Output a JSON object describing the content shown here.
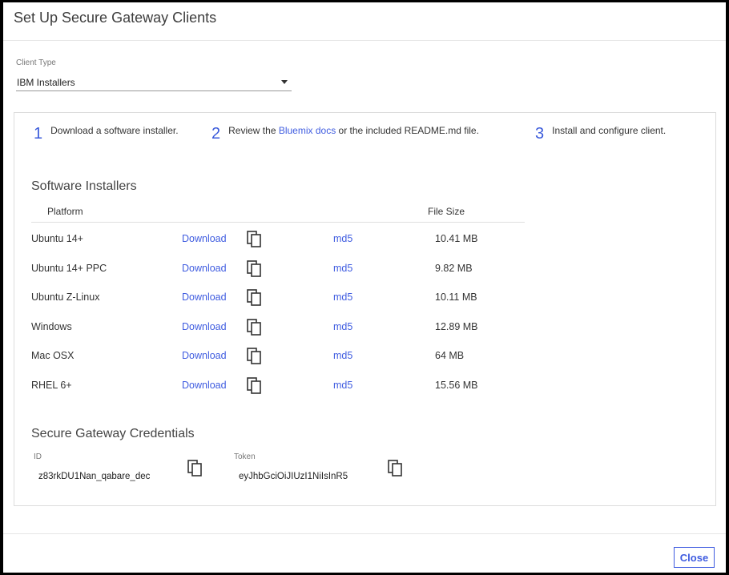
{
  "dialog": {
    "title": "Set Up Secure Gateway Clients",
    "close_label": "Close"
  },
  "client_type": {
    "label": "Client Type",
    "value": "IBM Installers"
  },
  "steps": [
    {
      "number": "1",
      "text": "Download a software installer."
    },
    {
      "number": "2",
      "prefix": "Review the ",
      "link": "Bluemix docs",
      "suffix": " or the included README.md file."
    },
    {
      "number": "3",
      "text": "Install and configure client."
    }
  ],
  "installers": {
    "title": "Software Installers",
    "col_platform": "Platform",
    "col_size": "File Size",
    "rows": [
      {
        "platform": "Ubuntu 14+",
        "download": "Download",
        "md5": "md5",
        "size": "10.41 MB"
      },
      {
        "platform": "Ubuntu 14+ PPC",
        "download": "Download",
        "md5": "md5",
        "size": "9.82 MB"
      },
      {
        "platform": "Ubuntu Z-Linux",
        "download": "Download",
        "md5": "md5",
        "size": "10.11 MB"
      },
      {
        "platform": "Windows",
        "download": "Download",
        "md5": "md5",
        "size": "12.89 MB"
      },
      {
        "platform": "Mac OSX",
        "download": "Download",
        "md5": "md5",
        "size": "64 MB"
      },
      {
        "platform": "RHEL 6+",
        "download": "Download",
        "md5": "md5",
        "size": "15.56 MB"
      }
    ]
  },
  "credentials": {
    "title": "Secure Gateway Credentials",
    "id_label": "ID",
    "id_value": "z83rkDU1Nan_qabare_dec",
    "token_label": "Token",
    "token_value": "eyJhbGciOiJIUzI1NiIsInR5"
  },
  "colors": {
    "accent": "#3f5ce0",
    "backdrop": "#000000"
  },
  "icons": {
    "copy": "copy-icon",
    "dropdown": "chevron-down-icon"
  }
}
